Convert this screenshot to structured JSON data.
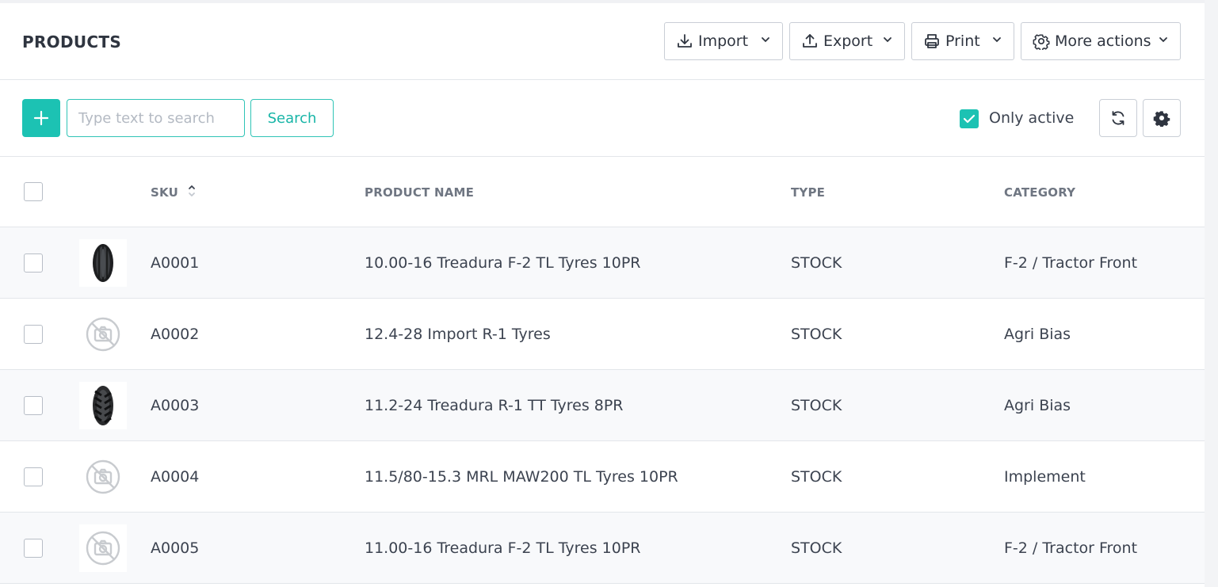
{
  "header": {
    "title": "PRODUCTS",
    "buttons": {
      "import": "Import",
      "export": "Export",
      "print": "Print",
      "more_actions": "More actions"
    }
  },
  "toolbar": {
    "search_placeholder": "Type text to search",
    "search_button": "Search",
    "only_active_label": "Only active",
    "only_active_checked": true
  },
  "colors": {
    "accent": "#1cc2b3",
    "border": "#c9ced6"
  },
  "table": {
    "columns": {
      "sku": "SKU",
      "product_name": "PRODUCT NAME",
      "type": "TYPE",
      "category": "CATEGORY"
    },
    "sort": {
      "column": "sku",
      "direction": "ascending"
    },
    "rows": [
      {
        "sku": "A0001",
        "name": "10.00-16 Treadura F-2 TL Tyres 10PR",
        "type": "STOCK",
        "category": "F-2 / Tractor Front",
        "image": "tyre-front-icon"
      },
      {
        "sku": "A0002",
        "name": "12.4-28 Import R-1 Tyres",
        "type": "STOCK",
        "category": "Agri Bias",
        "image": "no-image-icon"
      },
      {
        "sku": "A0003",
        "name": "11.2-24 Treadura R-1 TT Tyres 8PR",
        "type": "STOCK",
        "category": "Agri Bias",
        "image": "tyre-lug-icon"
      },
      {
        "sku": "A0004",
        "name": "11.5/80-15.3 MRL MAW200 TL Tyres 10PR",
        "type": "STOCK",
        "category": "Implement",
        "image": "no-image-icon"
      },
      {
        "sku": "A0005",
        "name": "11.00-16 Treadura F-2 TL Tyres 10PR",
        "type": "STOCK",
        "category": "F-2 / Tractor Front",
        "image": "no-image-icon"
      }
    ]
  }
}
